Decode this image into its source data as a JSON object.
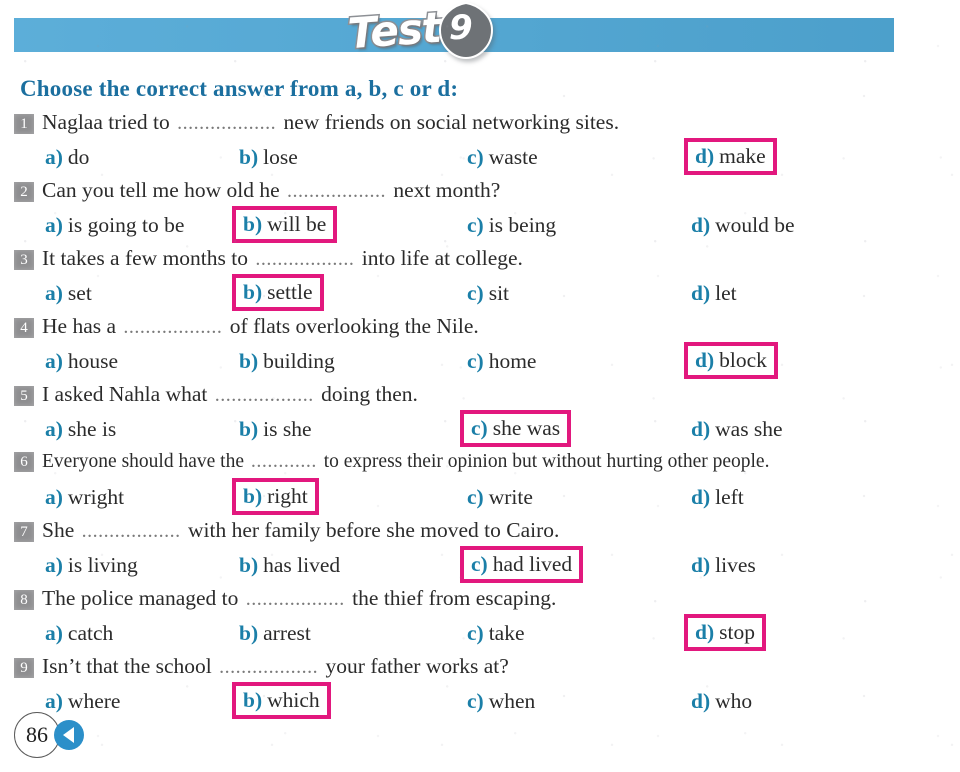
{
  "header": {
    "test_word": "Test",
    "test_number": "9",
    "banner_color": "#50a8d6"
  },
  "instruction": "Choose the correct answer from a, b, c or d:",
  "colors": {
    "heading": "#1b6f9f",
    "option_letter": "#1b7fa8",
    "highlight_box": "#e2187e",
    "number_badge": "#8e8e90"
  },
  "questions": [
    {
      "number": "1",
      "text_before": "Naglaa tried to",
      "blank": "..................",
      "text_after": "new friends on social networking sites.",
      "options": [
        {
          "letter": "a)",
          "text": "do",
          "selected": false
        },
        {
          "letter": "b)",
          "text": "lose",
          "selected": false
        },
        {
          "letter": "c)",
          "text": "waste",
          "selected": false
        },
        {
          "letter": "d)",
          "text": "make",
          "selected": true
        }
      ]
    },
    {
      "number": "2",
      "text_before": "Can you tell me how old he",
      "blank": "..................",
      "text_after": "next month?",
      "options": [
        {
          "letter": "a)",
          "text": "is going to be",
          "selected": false
        },
        {
          "letter": "b)",
          "text": "will be",
          "selected": true
        },
        {
          "letter": "c)",
          "text": "is being",
          "selected": false
        },
        {
          "letter": "d)",
          "text": "would be",
          "selected": false
        }
      ]
    },
    {
      "number": "3",
      "text_before": "It takes a few months to",
      "blank": "..................",
      "text_after": "into life at college.",
      "options": [
        {
          "letter": "a)",
          "text": "set",
          "selected": false
        },
        {
          "letter": "b)",
          "text": "settle",
          "selected": true
        },
        {
          "letter": "c)",
          "text": "sit",
          "selected": false
        },
        {
          "letter": "d)",
          "text": "let",
          "selected": false
        }
      ]
    },
    {
      "number": "4",
      "text_before": "He has a",
      "blank": "..................",
      "text_after": "of flats overlooking the Nile.",
      "options": [
        {
          "letter": "a)",
          "text": "house",
          "selected": false
        },
        {
          "letter": "b)",
          "text": "building",
          "selected": false
        },
        {
          "letter": "c)",
          "text": "home",
          "selected": false
        },
        {
          "letter": "d)",
          "text": "block",
          "selected": true
        }
      ]
    },
    {
      "number": "5",
      "text_before": "I asked Nahla what",
      "blank": "..................",
      "text_after": "doing then.",
      "options": [
        {
          "letter": "a)",
          "text": "she is",
          "selected": false
        },
        {
          "letter": "b)",
          "text": "is she",
          "selected": false
        },
        {
          "letter": "c)",
          "text": "she was",
          "selected": true
        },
        {
          "letter": "d)",
          "text": "was she",
          "selected": false
        }
      ]
    },
    {
      "number": "6",
      "text_before": "Everyone should have the",
      "blank": "............",
      "text_after": "to express their opinion but without hurting other people.",
      "compact": true,
      "options": [
        {
          "letter": "a)",
          "text": "wright",
          "selected": false
        },
        {
          "letter": "b)",
          "text": "right",
          "selected": true
        },
        {
          "letter": "c)",
          "text": "write",
          "selected": false
        },
        {
          "letter": "d)",
          "text": "left",
          "selected": false
        }
      ]
    },
    {
      "number": "7",
      "text_before": "She",
      "blank": "..................",
      "text_after": "with her family before she moved to Cairo.",
      "options": [
        {
          "letter": "a)",
          "text": "is living",
          "selected": false
        },
        {
          "letter": "b)",
          "text": "has lived",
          "selected": false
        },
        {
          "letter": "c)",
          "text": "had lived",
          "selected": true
        },
        {
          "letter": "d)",
          "text": "lives",
          "selected": false
        }
      ]
    },
    {
      "number": "8",
      "text_before": "The police managed to",
      "blank": "..................",
      "text_after": "the thief from escaping.",
      "options": [
        {
          "letter": "a)",
          "text": "catch",
          "selected": false
        },
        {
          "letter": "b)",
          "text": "arrest",
          "selected": false
        },
        {
          "letter": "c)",
          "text": "take",
          "selected": false
        },
        {
          "letter": "d)",
          "text": "stop",
          "selected": true
        }
      ]
    },
    {
      "number": "9",
      "text_before": "Isn’t that the school",
      "blank": "..................",
      "text_after": "your father works at?",
      "options": [
        {
          "letter": "a)",
          "text": "where",
          "selected": false
        },
        {
          "letter": "b)",
          "text": "which",
          "selected": true
        },
        {
          "letter": "c)",
          "text": "when",
          "selected": false
        },
        {
          "letter": "d)",
          "text": "who",
          "selected": false
        }
      ]
    }
  ],
  "footer": {
    "page_number": "86",
    "nav_icon": "previous-triangle-icon"
  }
}
